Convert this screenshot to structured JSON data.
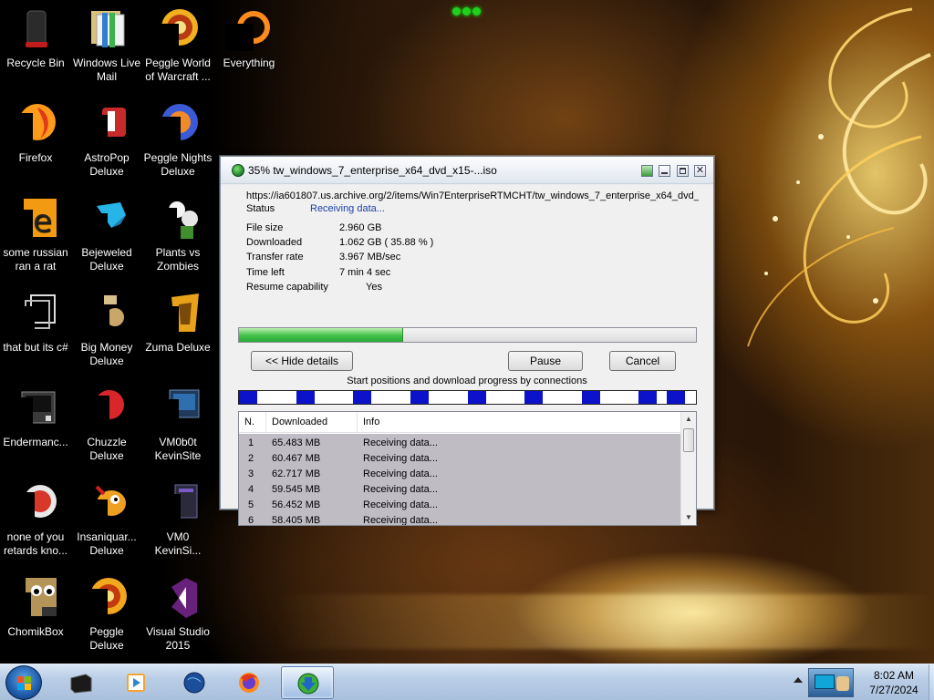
{
  "desktop": {
    "icons": [
      {
        "label": "Recycle Bin",
        "icon": "recycle-bin-icon"
      },
      {
        "label": "Windows Live Mail",
        "icon": "mail-icon"
      },
      {
        "label": "Peggle World of Warcraft ...",
        "icon": "peggle-icon"
      },
      {
        "label": "Everything",
        "icon": "search-app-icon"
      },
      {
        "label": "Firefox",
        "icon": "firefox-icon"
      },
      {
        "label": "AstroPop Deluxe",
        "icon": "astropop-icon"
      },
      {
        "label": "Peggle Nights Deluxe",
        "icon": "peggle-nights-icon"
      },
      {
        "label": "some russian ran a rat",
        "icon": "rat-app-icon"
      },
      {
        "label": "Bejeweled Deluxe",
        "icon": "bejeweled-icon"
      },
      {
        "label": "Plants vs Zombies",
        "icon": "plants-vs-zombies-icon"
      },
      {
        "label": "that but its c#",
        "icon": "shortcut-icon"
      },
      {
        "label": "Big Money Deluxe",
        "icon": "big-money-icon"
      },
      {
        "label": "Zuma Deluxe",
        "icon": "zuma-icon"
      },
      {
        "label": "Endermanc...",
        "icon": "monitor-icon"
      },
      {
        "label": "Chuzzle Deluxe",
        "icon": "chuzzle-icon"
      },
      {
        "label": "VM0b0t KevinSite",
        "icon": "vm-icon"
      },
      {
        "label": "none of you retards kno...",
        "icon": "browser-icon"
      },
      {
        "label": "Insaniquar... Deluxe",
        "icon": "insaniquarium-icon"
      },
      {
        "label": "VM0 KevinSi...",
        "icon": "file-icon"
      },
      {
        "label": "ChomikBox",
        "icon": "chomikbox-icon"
      },
      {
        "label": "Peggle Deluxe",
        "icon": "peggle-deluxe-icon"
      },
      {
        "label": "Visual Studio 2015",
        "icon": "visual-studio-icon"
      }
    ]
  },
  "dialog": {
    "title": "35% tw_windows_7_enterprise_x64_dvd_x15-...iso",
    "url": "https://ia601807.us.archive.org/2/items/Win7EnterpriseRTMCHT/tw_windows_7_enterprise_x64_dvd_",
    "status_label": "Status",
    "status_value": "Receiving data...",
    "fields": [
      {
        "label": "File size",
        "value": "2.960  GB"
      },
      {
        "label": "Downloaded",
        "value": "1.062  GB  ( 35.88 % )"
      },
      {
        "label": "Transfer rate",
        "value": "3.967  MB/sec"
      },
      {
        "label": "Time left",
        "value": "7 min 4 sec"
      },
      {
        "label": "Resume capability",
        "value": "Yes"
      }
    ],
    "progress_fraction": 0.3588,
    "buttons": {
      "hide_details": "<< Hide details",
      "pause": "Pause",
      "cancel": "Cancel"
    },
    "connections_label": "Start positions and download progress by connections",
    "connection_segments": [
      0.0,
      0.125,
      0.25,
      0.375,
      0.5,
      0.625,
      0.75,
      0.875,
      0.937
    ],
    "table": {
      "headers": [
        "N.",
        "Downloaded",
        "Info"
      ],
      "rows": [
        {
          "n": "1",
          "downloaded": "65.483  MB",
          "info": "Receiving data..."
        },
        {
          "n": "2",
          "downloaded": "60.467  MB",
          "info": "Receiving data..."
        },
        {
          "n": "3",
          "downloaded": "62.717  MB",
          "info": "Receiving data..."
        },
        {
          "n": "4",
          "downloaded": "59.545  MB",
          "info": "Receiving data..."
        },
        {
          "n": "5",
          "downloaded": "56.452  MB",
          "info": "Receiving data..."
        },
        {
          "n": "6",
          "downloaded": "58.405  MB",
          "info": "Receiving data..."
        }
      ]
    }
  },
  "taskbar": {
    "items": [
      {
        "icon": "terminal-icon"
      },
      {
        "icon": "media-player-icon"
      },
      {
        "icon": "globe-icon"
      },
      {
        "icon": "firefox-icon"
      },
      {
        "icon": "download-manager-icon",
        "active": true
      }
    ],
    "clock_time": "8:02 AM",
    "clock_date": "7/27/2024"
  },
  "colors": {
    "accent": "#1d3fa8",
    "progress": "#42c049",
    "connection": "#0b12c9",
    "row_background": "#bfbcc4"
  }
}
